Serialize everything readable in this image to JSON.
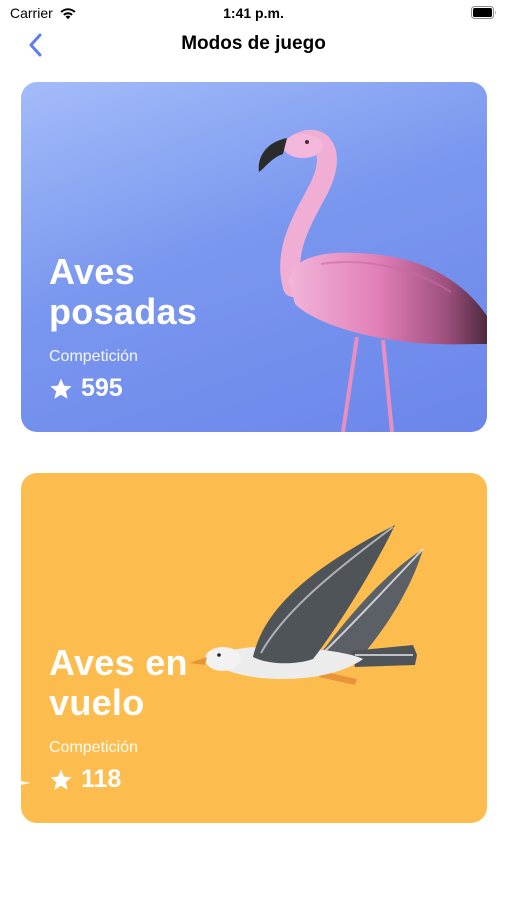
{
  "status_bar": {
    "carrier": "Carrier",
    "time": "1:41 p.m.",
    "icons": [
      "wifi-icon",
      "battery-icon"
    ]
  },
  "nav": {
    "back_icon": "chevron-left-icon",
    "title": "Modos de juego",
    "accent_color": "#5b7df0"
  },
  "modes": [
    {
      "title_line1": "Aves",
      "title_line2": "posadas",
      "subtitle": "Competición",
      "score": "595",
      "score_icon": "star-icon",
      "background": "#7a97ef",
      "illustration": "flamingo-illustration"
    },
    {
      "title_line1": "Aves en",
      "title_line2": "vuelo",
      "subtitle": "Competición",
      "score": "118",
      "score_icon": "star-icon",
      "background": "#fdbd4e",
      "illustration": "seagull-illustration"
    }
  ]
}
